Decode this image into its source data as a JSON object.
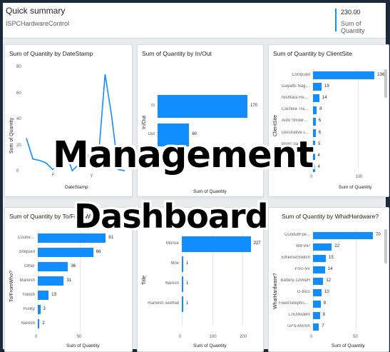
{
  "header": {
    "title": "Quick summary",
    "subtitle": "ISPCHardwareControl",
    "kpi_value": "230.00",
    "kpi_label": "Sum of Quantity"
  },
  "colors": {
    "bar": "#118dff",
    "line": "#118dff"
  },
  "overlay": {
    "line1": "Management",
    "line2": "Dashboard"
  },
  "chart_data": [
    {
      "type": "line",
      "title": "Sum of Quantity by DateStamp",
      "xlabel": "DateStamp",
      "ylabel": "Sum of Quantity",
      "yticks": [
        "80",
        "60",
        "40",
        "20",
        "0"
      ],
      "ylim": [
        0,
        80
      ],
      "y": [
        26,
        10,
        9,
        7,
        2,
        5,
        15,
        1,
        6,
        18,
        3,
        12,
        75,
        43,
        2,
        1
      ],
      "visible_fragments": [
        "F",
        "y"
      ]
    },
    {
      "type": "bar",
      "title": "Sum of Quantity by In/Out",
      "xlabel": "Sum of Quantity",
      "ylabel": "In/Out",
      "categories": [
        "In",
        "Out"
      ],
      "values": [
        170,
        60
      ]
    },
    {
      "type": "bar",
      "title": "Sum of Quantity by ClientSite",
      "xlabel": "Sum of Quantity",
      "ylabel": "ClientSite",
      "categories": [
        "Computel",
        "Gayathi Nagar ...",
        "Nishtara Reco...",
        "Cachika Tradin...",
        "Auto Showrop...",
        "Decorative La...",
        "Bilals Savoury ...",
        "...p E...",
        "...unte"
      ],
      "values": [
        136,
        19,
        14,
        8,
        6,
        6,
        5,
        4,
        4
      ],
      "xticks": [
        "0",
        "100"
      ]
    },
    {
      "type": "bar",
      "title": "Sum of Quantity by To/FromWho?",
      "xlabel": "Sum of Quantity",
      "ylabel": "To/FromWho?",
      "categories": [
        "CourierCo",
        "Shepard",
        "Other",
        "Manesh",
        "Yulesh",
        "Punky",
        "Naresh"
      ],
      "values": [
        81,
        66,
        36,
        31,
        13,
        3,
        2
      ],
      "xticks": [
        "0",
        "50"
      ]
    },
    {
      "type": "bar",
      "title": "Title",
      "xlabel": "Sum of Quantity",
      "ylabel": "Title",
      "categories": [
        "Monse",
        "Moe",
        "Naresh",
        "Ramesh seethat"
      ],
      "values": [
        227,
        1,
        1,
        1
      ],
      "xticks": [
        "0",
        "100",
        "200"
      ]
    },
    {
      "type": "bar",
      "title": "Sum of Quantity by WhatHardware?",
      "xlabel": "Sum of Quantity",
      "ylabel": "WhatHardware?",
      "categories": [
        "ConduitFpe...",
        "WiFiAP",
        "EthernetSwitch",
        "PSU-5V",
        "Battery-12v9aH",
        "G-Bics",
        "FixedTelephon...",
        "LTEModem",
        "UPS-650VA"
      ],
      "values": [
        70,
        22,
        15,
        14,
        12,
        10,
        9,
        8,
        7
      ],
      "xticks": [
        "0",
        "50"
      ]
    }
  ]
}
